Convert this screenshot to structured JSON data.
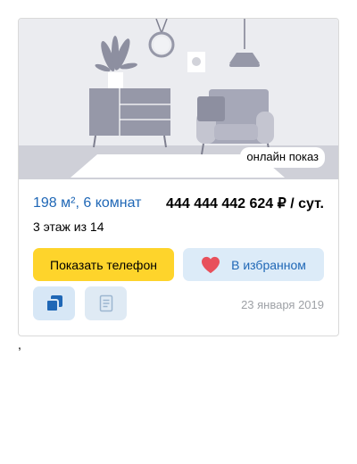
{
  "listing": {
    "badge": "онлайн показ",
    "area_rooms": "198 м², 6 комнат",
    "price": "444 444 442 624 ₽ / сут.",
    "floor": "3 этаж из 14",
    "show_phone_label": "Показать телефон",
    "favorite_label": "В избранном",
    "date": "23 января 2019"
  },
  "icons": {
    "favorite": "heart-icon",
    "copy": "copy-icon",
    "note": "note-icon"
  },
  "colors": {
    "primary_button": "#fed42b",
    "secondary_button": "#dcebf8",
    "link_text": "#1f67b6",
    "heart": "#e8505b"
  },
  "stray_text": ","
}
